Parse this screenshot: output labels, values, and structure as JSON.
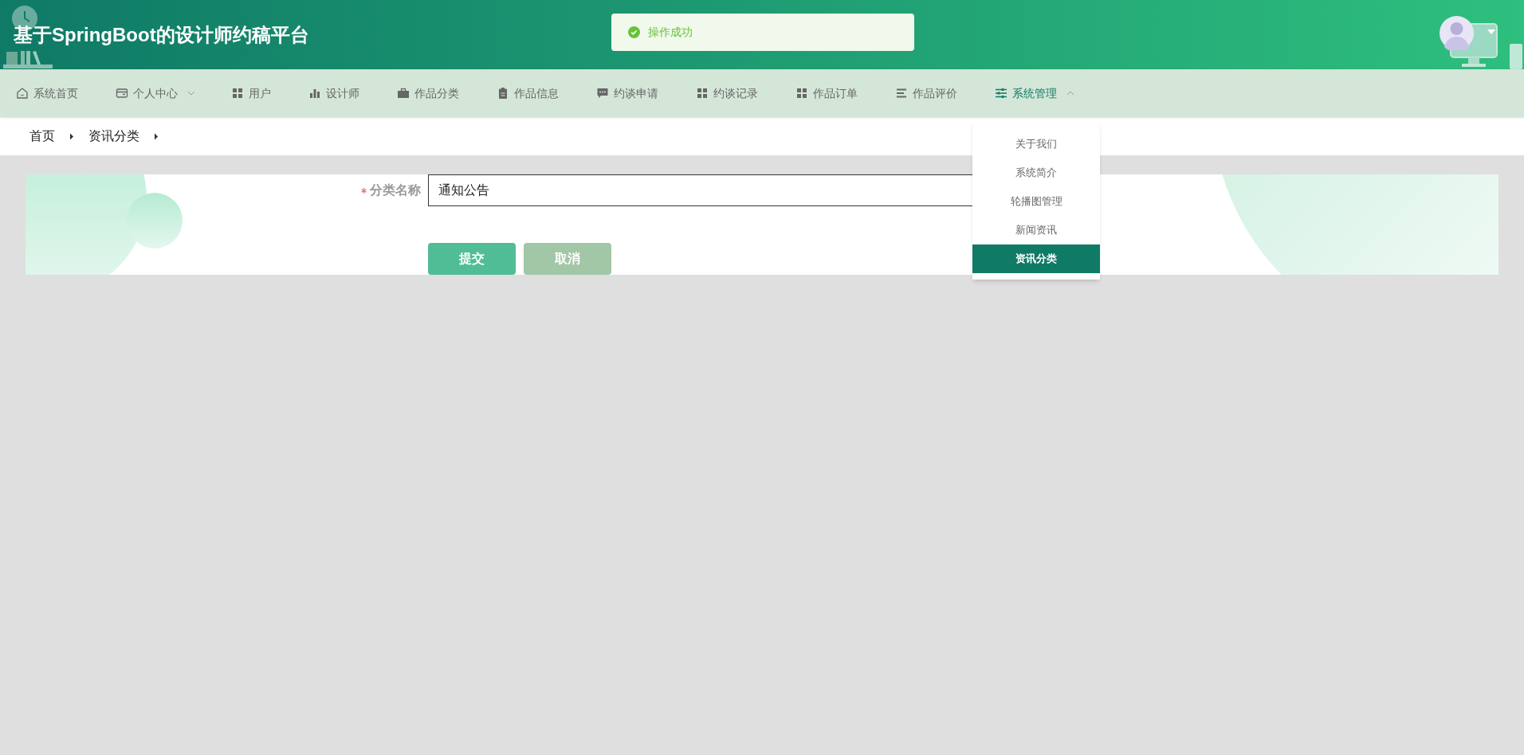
{
  "header": {
    "title": "基于SpringBoot的设计师约稿平台"
  },
  "toast": {
    "kind": "success",
    "text": "操作成功"
  },
  "nav": [
    {
      "label": "系统首页",
      "kind": "home",
      "dropdown": false,
      "selected": false
    },
    {
      "label": "个人中心",
      "kind": "wallet",
      "dropdown": true,
      "selected": false
    },
    {
      "label": "用户",
      "kind": "grid",
      "dropdown": false,
      "selected": false
    },
    {
      "label": "设计师",
      "kind": "bars",
      "dropdown": false,
      "selected": false
    },
    {
      "label": "作品分类",
      "kind": "briefcase",
      "dropdown": false,
      "selected": false
    },
    {
      "label": "作品信息",
      "kind": "clipboard",
      "dropdown": false,
      "selected": false
    },
    {
      "label": "约谈申请",
      "kind": "chat",
      "dropdown": false,
      "selected": false
    },
    {
      "label": "约谈记录",
      "kind": "grid",
      "dropdown": false,
      "selected": false
    },
    {
      "label": "作品订单",
      "kind": "grid",
      "dropdown": false,
      "selected": false
    },
    {
      "label": "作品评价",
      "kind": "lines",
      "dropdown": false,
      "selected": false
    },
    {
      "label": "系统管理",
      "kind": "sliders",
      "dropdown": true,
      "selected": true,
      "expanded": true,
      "children": [
        {
          "label": "关于我们",
          "selected": false
        },
        {
          "label": "系统简介",
          "selected": false
        },
        {
          "label": "轮播图管理",
          "selected": false
        },
        {
          "label": "新闻资讯",
          "selected": false
        },
        {
          "label": "资讯分类",
          "selected": true
        }
      ]
    }
  ],
  "breadcrumb": [
    "首页",
    "资讯分类"
  ],
  "form": {
    "fields": [
      {
        "label": "分类名称",
        "required": true,
        "value": "通知公告"
      }
    ],
    "buttons": [
      {
        "label": "提交",
        "kind": "primary"
      },
      {
        "label": "取消",
        "kind": "secondary"
      }
    ]
  }
}
